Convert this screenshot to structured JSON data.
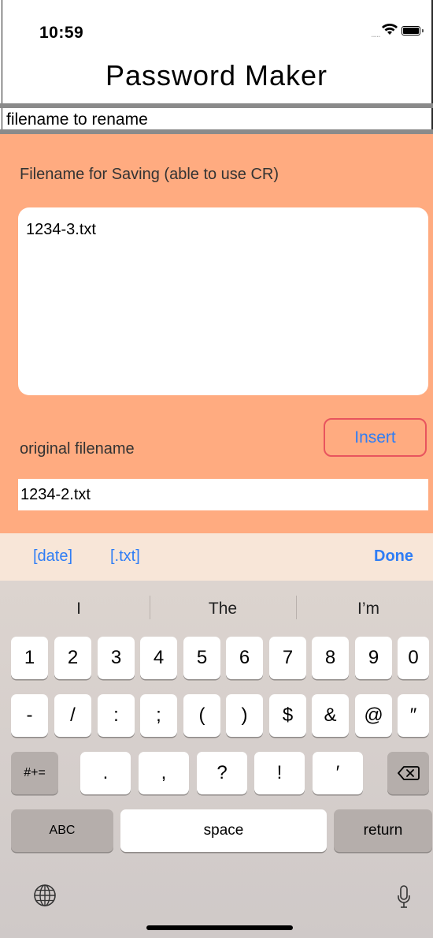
{
  "status_bar": {
    "time": "10:59",
    "signal": "....."
  },
  "title": "Password Maker",
  "rename_field": {
    "value": "filename to rename"
  },
  "save_section": {
    "label": "Filename for Saving (able to use CR)",
    "value": "1234-3.txt"
  },
  "original_section": {
    "label": "original filename",
    "insert_label": "Insert",
    "value": "1234-2.txt"
  },
  "accessory": {
    "date_label": "[date]",
    "txt_label": "[.txt]",
    "done_label": "Done"
  },
  "keyboard": {
    "suggestions": [
      "I",
      "The",
      "I’m"
    ],
    "row1": [
      "1",
      "2",
      "3",
      "4",
      "5",
      "6",
      "7",
      "8",
      "9",
      "0"
    ],
    "row2": [
      "-",
      "/",
      ":",
      ";",
      "(",
      ")",
      "$",
      "&",
      "@",
      "″"
    ],
    "row3": [
      ".",
      ",",
      "?",
      "!",
      "′"
    ],
    "symbols_label": "#+=",
    "abc_label": "ABC",
    "space_label": "space",
    "return_label": "return",
    "backspace_icon": "backspace-icon",
    "globe_icon": "globe-icon",
    "mic_icon": "microphone-icon"
  },
  "colors": {
    "panel": "#ffab80",
    "accent": "#2f7df5",
    "insert_border": "#e8545e",
    "accessory_bg": "#f8e6d8"
  }
}
